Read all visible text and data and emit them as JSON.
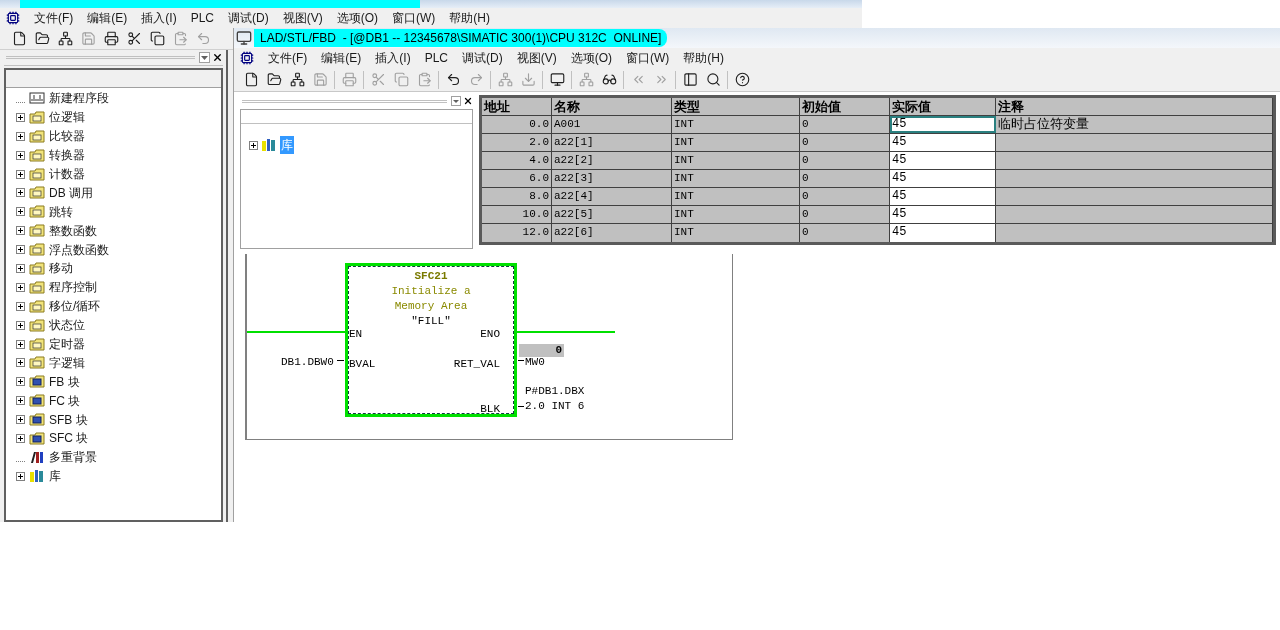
{
  "back_window": {
    "menu": [
      "文件(F)",
      "编辑(E)",
      "插入(I)",
      "PLC",
      "调试(D)",
      "视图(V)",
      "选项(O)",
      "窗口(W)",
      "帮助(H)"
    ],
    "tree": [
      {
        "label": "新建程序段",
        "kind": "network"
      },
      {
        "label": "位逻辑",
        "kind": "folder"
      },
      {
        "label": "比较器",
        "kind": "folder"
      },
      {
        "label": "转换器",
        "kind": "folder"
      },
      {
        "label": "计数器",
        "kind": "folder"
      },
      {
        "label": "DB 调用",
        "kind": "folder"
      },
      {
        "label": "跳转",
        "kind": "folder"
      },
      {
        "label": "整数函数",
        "kind": "folder"
      },
      {
        "label": "浮点数函数",
        "kind": "folder"
      },
      {
        "label": "移动",
        "kind": "folder"
      },
      {
        "label": "程序控制",
        "kind": "folder"
      },
      {
        "label": "移位/循环",
        "kind": "folder"
      },
      {
        "label": "状态位",
        "kind": "folder"
      },
      {
        "label": "定时器",
        "kind": "folder"
      },
      {
        "label": "字逻辑",
        "kind": "folder"
      },
      {
        "label": "FB 块",
        "kind": "block_folder"
      },
      {
        "label": "FC 块",
        "kind": "block_folder"
      },
      {
        "label": "SFB 块",
        "kind": "block_folder"
      },
      {
        "label": "SFC 块",
        "kind": "block_folder"
      },
      {
        "label": "多重背景",
        "kind": "multi"
      },
      {
        "label": "库",
        "kind": "library"
      }
    ]
  },
  "front_window": {
    "title": "LAD/STL/FBD  - [@DB1 -- 12345678\\SIMATIC 300(1)\\CPU 312C  ONLINE]",
    "menu": [
      "文件(F)",
      "编辑(E)",
      "插入(I)",
      "PLC",
      "调试(D)",
      "视图(V)",
      "选项(O)",
      "窗口(W)",
      "帮助(H)"
    ],
    "library_tree": [
      {
        "label": "库",
        "selected": true
      }
    ],
    "table": {
      "columns": [
        "地址",
        "名称",
        "类型",
        "初始值",
        "实际值",
        "注释"
      ],
      "rows": [
        {
          "address": "0.0",
          "name": "A001",
          "type": "INT",
          "initial": "0",
          "actual": "45",
          "comment": "临时占位符变量",
          "focused": true
        },
        {
          "address": "2.0",
          "name": "a22[1]",
          "type": "INT",
          "initial": "0",
          "actual": "45",
          "focused": false
        },
        {
          "address": "4.0",
          "name": "a22[2]",
          "type": "INT",
          "initial": "0",
          "actual": "45",
          "focused": false
        },
        {
          "address": "6.0",
          "name": "a22[3]",
          "type": "INT",
          "initial": "0",
          "actual": "45",
          "focused": false
        },
        {
          "address": "8.0",
          "name": "a22[4]",
          "type": "INT",
          "initial": "0",
          "actual": "45",
          "focused": false
        },
        {
          "address": "10.0",
          "name": "a22[5]",
          "type": "INT",
          "initial": "0",
          "actual": "45",
          "focused": false
        },
        {
          "address": "12.0",
          "name": "a22[6]",
          "type": "INT",
          "initial": "0",
          "actual": "45",
          "focused": false
        }
      ]
    },
    "diagram": {
      "block_number": "SFC21",
      "description_lines": [
        "Initialize a",
        "Memory Area"
      ],
      "symbol": "\"FILL\"",
      "pin_en": "EN",
      "pin_eno": "ENO",
      "pin_bval": "BVAL",
      "pin_ret_val": "RET_VAL",
      "pin_blk": "BLK",
      "bval_operand": "DB1.DBW0",
      "ret_val_operand": "MW0",
      "ret_val_status": "0",
      "blk_operand_lines": [
        "P#DB1.DBX",
        "2.0 INT 6"
      ],
      "powered": true
    }
  }
}
